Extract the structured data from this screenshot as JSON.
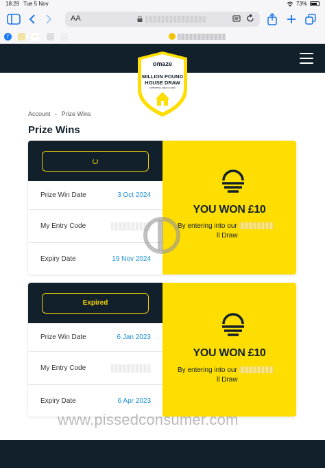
{
  "status_bar": {
    "time": "18:29",
    "date": "Tue 5 Nov",
    "battery": "73%"
  },
  "browser": {
    "text_size_label": "AA"
  },
  "breadcrumb": {
    "items": [
      "Account",
      "-",
      "Prize Wins"
    ]
  },
  "page_title": "Prize Wins",
  "logo": {
    "brand": "omaze",
    "line1": "MILLION POUND",
    "line2": "HOUSE DRAW",
    "tagline": "SUPPORTING GREAT CAUSES"
  },
  "wins": [
    {
      "status": "",
      "status_loading": true,
      "rows": [
        {
          "label": "Prize Win Date",
          "value": "3 Oct 2024"
        },
        {
          "label": "My Entry Code",
          "value": ""
        },
        {
          "label": "Expiry Date",
          "value": "19 Nov 2024"
        }
      ],
      "title": "YOU WON £10",
      "desc_start": "By entering into our",
      "desc_end": "ll Draw"
    },
    {
      "status": "Expired",
      "status_loading": false,
      "rows": [
        {
          "label": "Prize Win Date",
          "value": "6 Jan 2023"
        },
        {
          "label": "My Entry Code",
          "value": ""
        },
        {
          "label": "Expiry Date",
          "value": "6 Apr 2023"
        }
      ],
      "title": "YOU WON £10",
      "desc_start": "By entering into our",
      "desc_end": "ll Draw"
    }
  ],
  "watermark": "www.pissedconsumer.com",
  "colors": {
    "navy": "#11202b",
    "yellow": "#fedd00",
    "link_blue": "#1a8fd6"
  }
}
